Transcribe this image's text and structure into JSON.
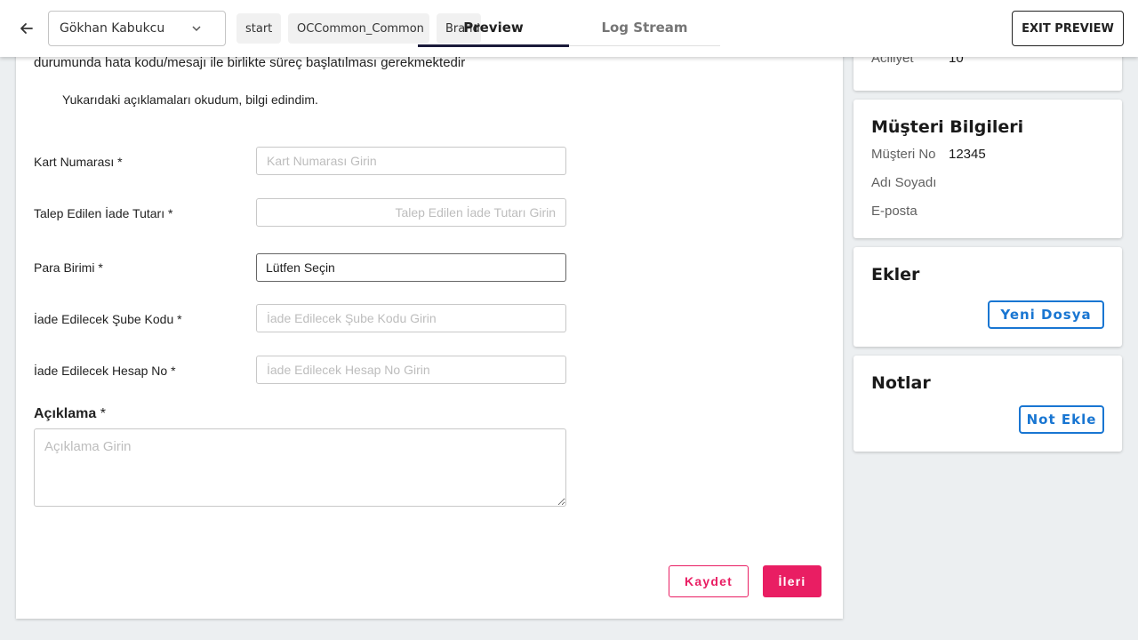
{
  "topbar": {
    "user_name": "Gökhan Kabukcu",
    "chips": [
      "start",
      "OCCommon_Common",
      "Brand"
    ],
    "tabs": [
      {
        "label": "Preview",
        "active": true
      },
      {
        "label": "Log Stream",
        "active": false
      }
    ],
    "exit_label": "EXIT PREVIEW"
  },
  "form": {
    "intro_text": "durumunda hata kodu/mesajı ile birlikte süreç başlatılması gerekmektedir",
    "ack_text": "Yukarıdaki açıklamaları okudum, bilgi edindim.",
    "card_number": {
      "label": "Kart Numarası *",
      "placeholder": "Kart Numarası Girin"
    },
    "refund_amount": {
      "label": "Talep Edilen İade Tutarı *",
      "placeholder": "Talep Edilen İade Tutarı Girin"
    },
    "currency": {
      "label": "Para Birimi *",
      "value": "Lütfen Seçin"
    },
    "branch_code": {
      "label": "İade Edilecek Şube Kodu *",
      "placeholder": "İade Edilecek Şube Kodu Girin"
    },
    "account_no": {
      "label": "İade Edilecek Hesap No *",
      "placeholder": "İade Edilecek Hesap No Girin"
    },
    "description": {
      "label": "Açıklama",
      "required_mark": "*",
      "placeholder": "Açıklama Girin"
    },
    "save_label": "Kaydet",
    "next_label": "İleri"
  },
  "sidebar": {
    "priority": {
      "label": "Aciliyet",
      "value": "10"
    },
    "customer": {
      "title": "Müşteri Bilgileri",
      "fields": [
        {
          "label": "Müşteri No",
          "value": "12345"
        },
        {
          "label": "Adı Soyadı",
          "value": ""
        },
        {
          "label": "E-posta",
          "value": ""
        }
      ]
    },
    "attachments": {
      "title": "Ekler",
      "button": "Yeni Dosya"
    },
    "notes": {
      "title": "Notlar",
      "button": "Not Ekle"
    }
  },
  "colors": {
    "primary_pink": "#e91e63",
    "primary_blue": "#1976d2",
    "tab_indicator": "#1a1a3a",
    "background": "#eceff1"
  },
  "icons": {
    "back": "arrow-left-icon",
    "dropdown": "chevron-down-icon",
    "resize": "resize-handle-icon"
  }
}
